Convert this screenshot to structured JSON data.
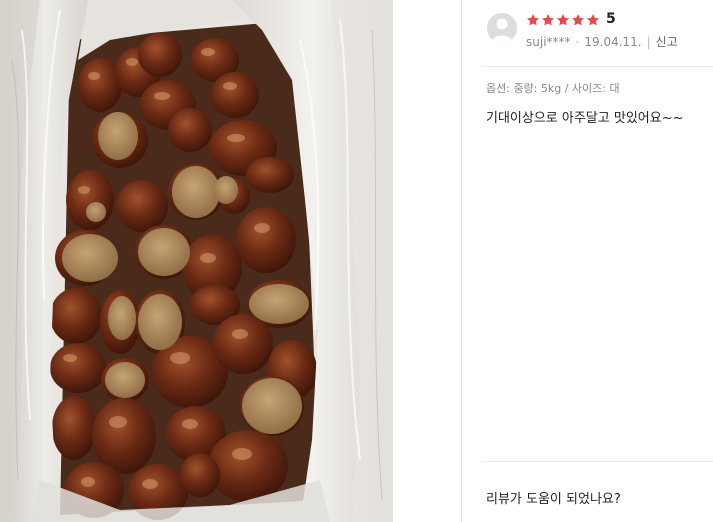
{
  "photo": {
    "alt_semantic": "chestnuts-in-box-photo"
  },
  "review": {
    "rating_value": "5",
    "stars_filled": 5,
    "stars_total": 5,
    "star_color": "#e84a4a",
    "user_id": "suji****",
    "separator": "·",
    "date": "19.04.11.",
    "divider": "|",
    "report_label": "신고",
    "options_text": "옵션: 중량: 5kg / 사이즈: 대",
    "body_text": "기대이상으로 아주달고 맛있어요~~",
    "helpful_question": "리뷰가 도움이 되었나요?"
  }
}
